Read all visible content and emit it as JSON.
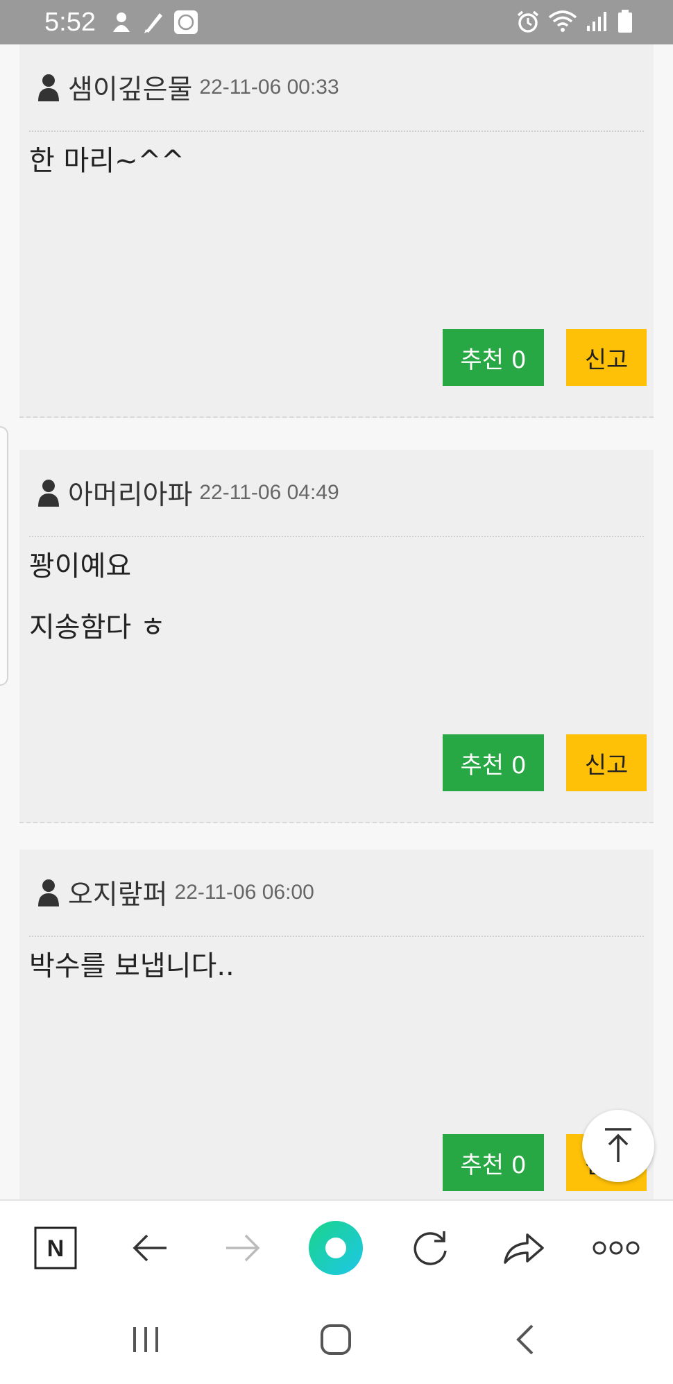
{
  "status": {
    "time": "5:52",
    "left_icons": [
      "person-notification-icon",
      "pen-notification-icon",
      "app-notification-icon"
    ],
    "right_icons": [
      "alarm-icon",
      "wifi-icon",
      "signal-icon",
      "battery-icon"
    ]
  },
  "comments": [
    {
      "author": "샘이깊은물",
      "date": "22-11-06 00:33",
      "body": [
        "한 마리~^^"
      ],
      "recommend_label": "추천 0",
      "report_label": "신고"
    },
    {
      "author": "아머리아파",
      "date": "22-11-06 04:49",
      "body": [
        "꽝이예요",
        "지송함다 ㅎ"
      ],
      "recommend_label": "추천 0",
      "report_label": "신고"
    },
    {
      "author": "오지랖퍼",
      "date": "22-11-06 06:00",
      "body": [
        "박수를 보냅니다.."
      ],
      "recommend_label": "추천 0",
      "report_label": "신고"
    }
  ],
  "browser": {
    "home_logo_letter": "N",
    "colors": {
      "accent_green": "#28a745",
      "accent_yellow": "#ffc107",
      "home_gradient_start": "#19d48a",
      "home_gradient_end": "#1ec7e8"
    }
  }
}
